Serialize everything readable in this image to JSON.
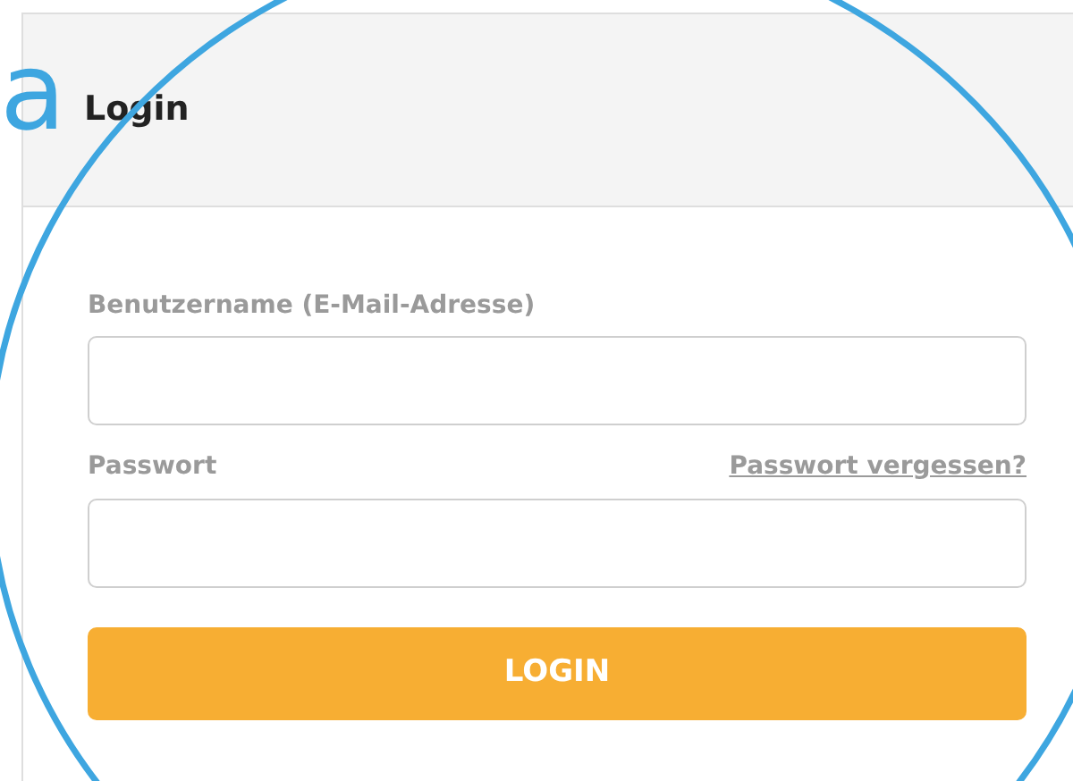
{
  "annotation": {
    "label": "a"
  },
  "panel": {
    "title": "Login"
  },
  "form": {
    "username_label": "Benutzername (E-Mail-Adresse)",
    "password_label": "Passwort",
    "forgot_link": "Passwort vergessen?",
    "submit": "LOGIN"
  }
}
